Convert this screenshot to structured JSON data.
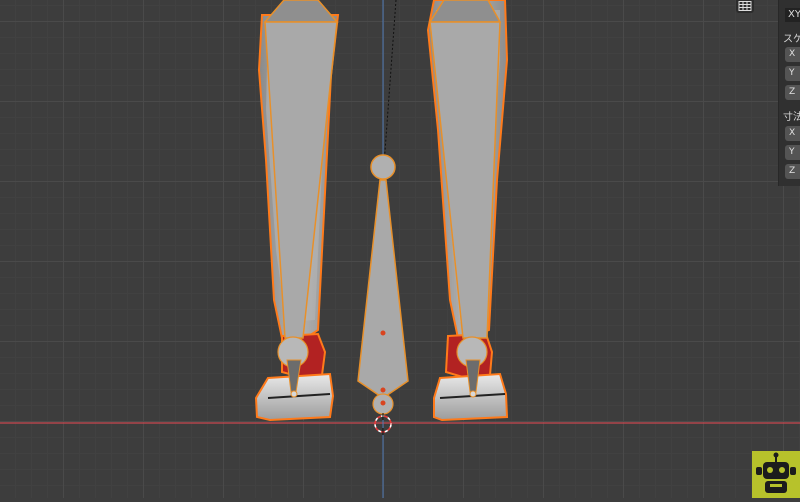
{
  "viewport": {
    "mode": "3D viewport – front orthographic view, leg armature bones selected",
    "colors": {
      "background": "#3d3d3d",
      "x_axis": "#c9474f",
      "z_axis": "#4d78b2",
      "selection_outline": "#ff7a1a",
      "bone": "#a9a9a9",
      "bone_selected_edge": "#e8902a"
    },
    "grid_toggle_icon": "grid-icon"
  },
  "npanel": {
    "header": "XY",
    "scale_label": "スケ",
    "scale_fields": [
      "X",
      "Y",
      "Z"
    ],
    "dimensions_label": "寸法",
    "dimension_fields": [
      "X",
      "Y",
      "Z"
    ]
  },
  "logo": {
    "name": "robot-icon",
    "color": "#b7c22b"
  }
}
